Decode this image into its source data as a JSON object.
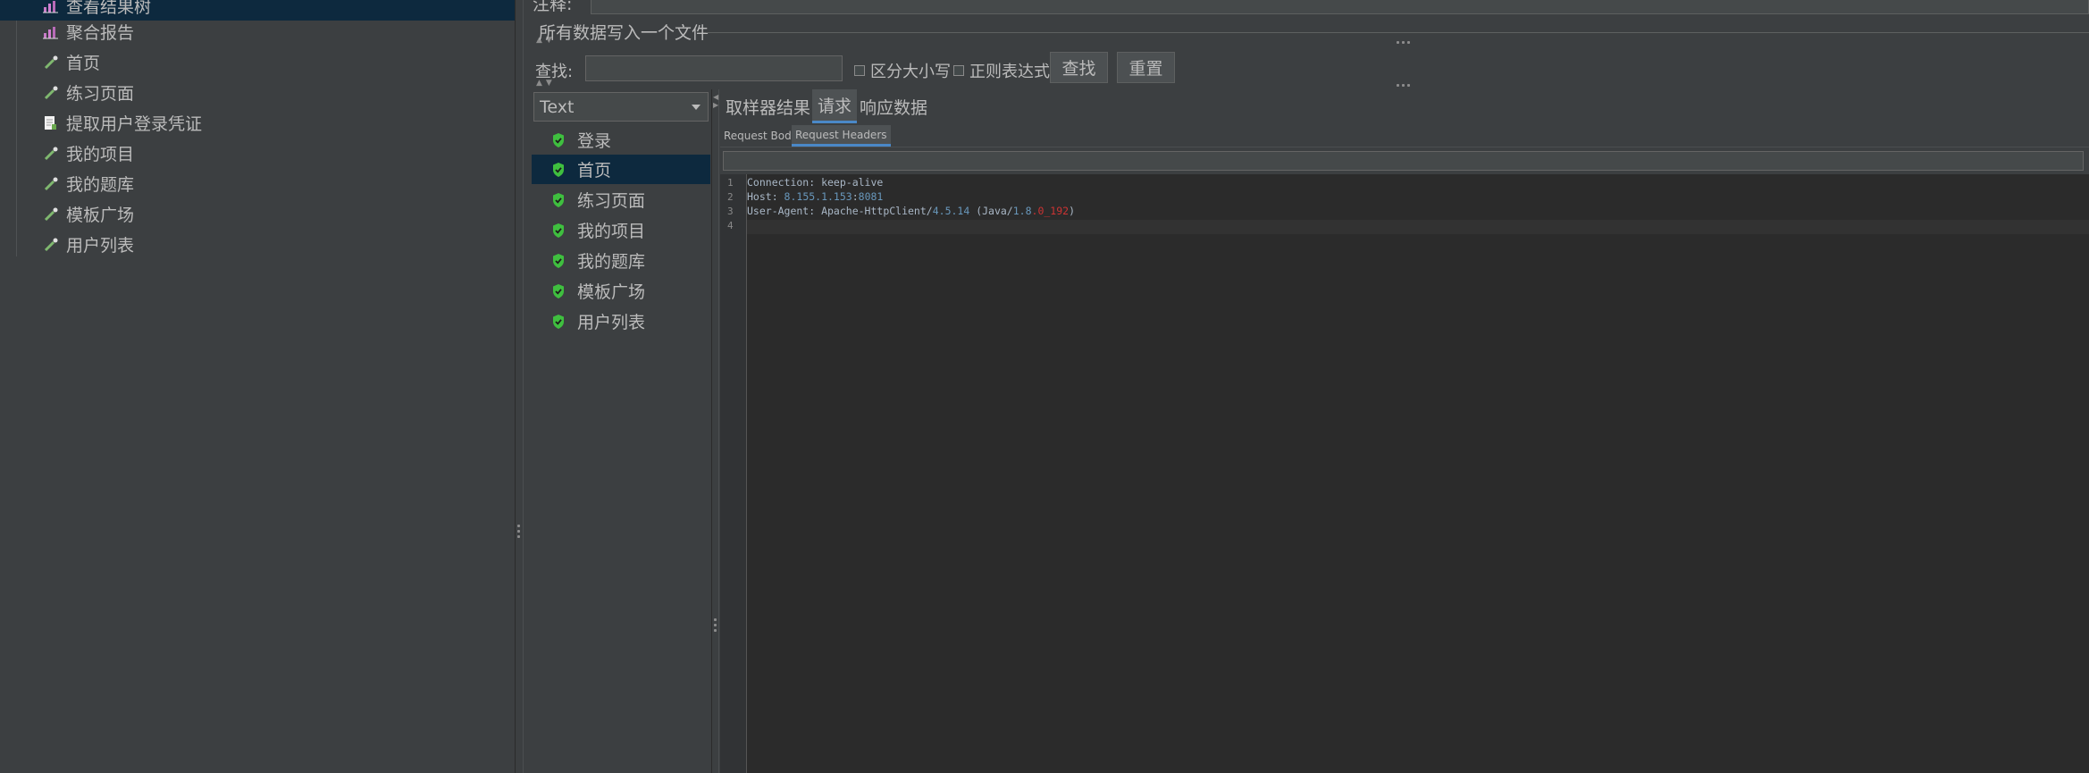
{
  "tree": {
    "items": [
      {
        "label": "查看结果树",
        "icon": "graph-icon",
        "selected": true
      },
      {
        "label": "聚合报告",
        "icon": "graph-icon"
      },
      {
        "label": "首页",
        "icon": "pipette-icon"
      },
      {
        "label": "练习页面",
        "icon": "pipette-icon"
      },
      {
        "label": "提取用户登录凭证",
        "icon": "document-icon"
      },
      {
        "label": "我的项目",
        "icon": "pipette-icon"
      },
      {
        "label": "我的题库",
        "icon": "pipette-icon"
      },
      {
        "label": "模板广场",
        "icon": "pipette-icon"
      },
      {
        "label": "用户列表",
        "icon": "pipette-icon"
      }
    ]
  },
  "top": {
    "comment_label": "注释:",
    "file_legend": "所有数据写入一个文件"
  },
  "search": {
    "label": "查找:",
    "value": "",
    "case_label": "区分大小写",
    "regex_label": "正则表达式",
    "find_button": "查找",
    "reset_button": "重置"
  },
  "results": {
    "renderer": "Text",
    "items": [
      {
        "label": "登录"
      },
      {
        "label": "首页",
        "selected": true
      },
      {
        "label": "练习页面"
      },
      {
        "label": "我的项目"
      },
      {
        "label": "我的题库"
      },
      {
        "label": "模板广场"
      },
      {
        "label": "用户列表"
      }
    ]
  },
  "tabs": {
    "items": [
      "取样器结果",
      "请求",
      "响应数据"
    ],
    "active": "请求"
  },
  "subtabs": {
    "items": [
      "Request Body",
      "Request Headers"
    ],
    "active": "Request Headers"
  },
  "editor": {
    "line_numbers": [
      "1",
      "2",
      "3",
      "4"
    ],
    "line1": "Connection: keep-alive",
    "line2_key": "Host: ",
    "line2_ip": "8.155.1.153",
    "line2_colon": ":",
    "line2_port": "8081",
    "line3_key": "User-Agent: Apache-HttpClient/",
    "line3_ver": "4.5.14",
    "line3_mid": " (Java/",
    "line3_jv": "1.8",
    "line3_upd": ".0_192",
    "line3_end": ")"
  },
  "colors": {
    "background": "#3c3f41",
    "editor_bg": "#2b2b2b",
    "selection": "#0d293e",
    "tab_accent": "#4a88c7",
    "number": "#6897bb",
    "error_red": "#cc3333",
    "check_green": "#3fbf3f"
  }
}
